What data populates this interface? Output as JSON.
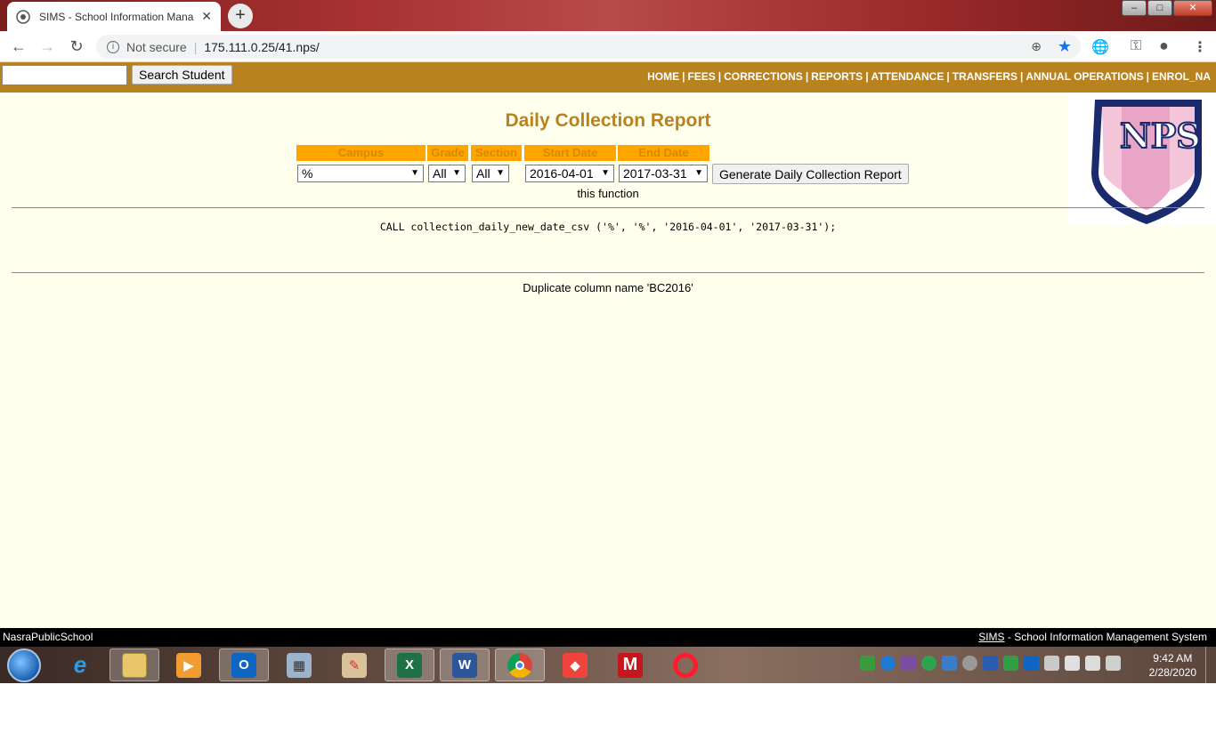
{
  "browser": {
    "tab_title": "SIMS - School Information Mana",
    "new_tab_symbol": "+",
    "close_symbol": "✕",
    "security_label": "Not secure",
    "url": "175.111.0.25/41.nps/"
  },
  "header": {
    "search_button": "Search Student",
    "nav": [
      "HOME",
      "FEES",
      "CORRECTIONS",
      "REPORTS",
      "ATTENDANCE",
      "TRANSFERS",
      "ANNUAL OPERATIONS",
      "ENROL_NA"
    ]
  },
  "report": {
    "title": "Daily Collection Report",
    "columns": {
      "campus": "Campus",
      "grade": "Grade",
      "section": "Section",
      "start_date": "Start Date",
      "end_date": "End Date"
    },
    "values": {
      "campus": "%",
      "grade": "All",
      "section": "All",
      "start_date": "2016-04-01",
      "end_date": "2017-03-31"
    },
    "generate_button": "Generate Daily Collection Report",
    "note": "this function",
    "sql": "CALL collection_daily_new_date_csv ('%', '%', '2016-04-01', '2017-03-31');",
    "error": "Duplicate column name 'BC2016'",
    "logo_text": "NPS"
  },
  "footer": {
    "school": "NasraPublicSchool",
    "sims_link": "SIMS",
    "system_name": " - School Information Management System"
  },
  "taskbar": {
    "time": "9:42 AM",
    "date": "2/28/2020"
  },
  "colors": {
    "brand": "#b8821f",
    "header_bg": "#ffa500",
    "content_bg": "#ffffee"
  }
}
